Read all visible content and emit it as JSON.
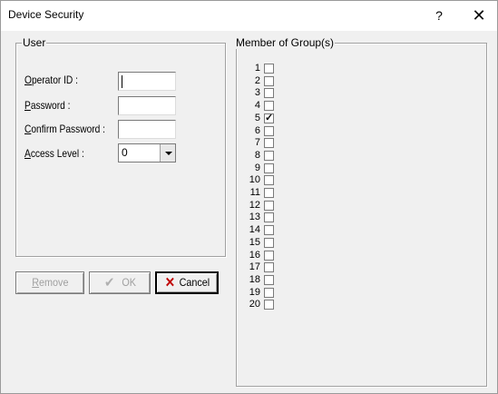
{
  "window": {
    "title": "Device Security",
    "help_label": "?",
    "close_label": "✕"
  },
  "user_group": {
    "legend": "User",
    "operator_id": {
      "accesskey": "O",
      "label_rest": "perator ID :",
      "value": ""
    },
    "password": {
      "accesskey": "P",
      "label_rest": "assword :",
      "value": ""
    },
    "confirm_password": {
      "accesskey": "C",
      "label_rest": "onfirm Password :",
      "value": ""
    },
    "access_level": {
      "accesskey": "A",
      "label_rest": "ccess Level :",
      "value": "0"
    }
  },
  "buttons": {
    "remove": {
      "accesskey": "R",
      "label_rest": "emove",
      "enabled": false
    },
    "ok": {
      "label": "OK",
      "enabled": false,
      "icon": "check-icon"
    },
    "cancel": {
      "label": "Cancel",
      "enabled": true,
      "icon": "x-icon"
    }
  },
  "groups": {
    "legend": "Member of Group(s)",
    "items": [
      {
        "n": "1",
        "checked": false
      },
      {
        "n": "2",
        "checked": false
      },
      {
        "n": "3",
        "checked": false
      },
      {
        "n": "4",
        "checked": false
      },
      {
        "n": "5",
        "checked": true
      },
      {
        "n": "6",
        "checked": false
      },
      {
        "n": "7",
        "checked": false
      },
      {
        "n": "8",
        "checked": false
      },
      {
        "n": "9",
        "checked": false
      },
      {
        "n": "10",
        "checked": false
      },
      {
        "n": "11",
        "checked": false
      },
      {
        "n": "12",
        "checked": false
      },
      {
        "n": "13",
        "checked": false
      },
      {
        "n": "14",
        "checked": false
      },
      {
        "n": "15",
        "checked": false
      },
      {
        "n": "16",
        "checked": false
      },
      {
        "n": "17",
        "checked": false
      },
      {
        "n": "18",
        "checked": false
      },
      {
        "n": "19",
        "checked": false
      },
      {
        "n": "20",
        "checked": false
      }
    ]
  },
  "colors": {
    "dialog_bg": "#f0f0f0",
    "cancel_icon": "#c00000"
  }
}
